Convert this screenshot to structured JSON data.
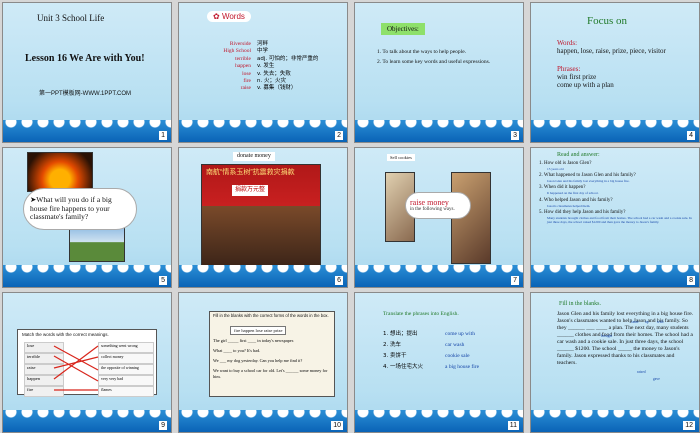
{
  "colors": {
    "accent_red": "#c0172c",
    "accent_blue": "#1646a8",
    "wave": "#0a63b6"
  },
  "slides": [
    {
      "num": "1",
      "unit": "Unit 3  School Life",
      "lesson": "Lesson 16  We Are with You!",
      "site": "第一PPT模板网-WWW.1PPT.COM"
    },
    {
      "num": "2",
      "heading": "Words",
      "words": [
        {
          "en": "Riverside",
          "cn": "河畔"
        },
        {
          "en": "High School",
          "cn": "中学"
        },
        {
          "en": "terrible",
          "cn": "adj. 可怕的；非常严重的"
        },
        {
          "en": "happen",
          "cn": "v. 发生"
        },
        {
          "en": "lose",
          "cn": "v. 失去；失败"
        },
        {
          "en": "fire",
          "cn": "n. 火；火灾"
        },
        {
          "en": "raise",
          "cn": "v. 募集（钱财）"
        }
      ]
    },
    {
      "num": "3",
      "heading": "Objectives:",
      "items": [
        "1. To talk about the ways to help people.",
        "2. To learn some key words and useful expressions."
      ]
    },
    {
      "num": "4",
      "heading": "Focus on",
      "words_label": "Words:",
      "words": "happen, lose, raise, prize, piece, visitor",
      "phrases_label": "Phrases:",
      "phrases": [
        "win first prize",
        "come up with a plan"
      ]
    },
    {
      "num": "5",
      "question": "What will you do if a big house fire happens to your classmate's family?"
    },
    {
      "num": "6",
      "label": "donate money",
      "banner": "南航“情系玉树”抗震救灾捐款",
      "board": "捐款万元整"
    },
    {
      "num": "7",
      "tag": "Sell cookies",
      "bubble": "raise money",
      "bubble_sub": "in the following ways."
    },
    {
      "num": "8",
      "heading": "Read and answer:",
      "qa": [
        {
          "q": "1. How old is Jason Glen?",
          "a": "15 years old"
        },
        {
          "q": "2. What happened to Jason Glen and his family?",
          "a": "Jason Glen and his family lost everything in a big house fire."
        },
        {
          "q": "3. When did it happen?",
          "a": "It happened on the first day of school."
        },
        {
          "q": "4. Who helped Jason and his family?",
          "a": "Jason's classmates helped them."
        },
        {
          "q": "5. How did they help Jason and his family?",
          "a": "Many students brought clothes and food from their homes. The school had a car wash and a cookie sale. In just three days, the school raised $1200 and then gave the money to Jason's family."
        }
      ]
    },
    {
      "num": "9",
      "heading": "Match the words with the correct meanings.",
      "left": [
        "lose",
        "terrible",
        "raise",
        "happen",
        "fire"
      ],
      "right": [
        "something went wrong",
        "collect money",
        "the opposite of winning",
        "very very bad",
        "flames"
      ]
    },
    {
      "num": "10",
      "heading": "Fill in the blanks with the correct forms of the words in the box.",
      "box": "fire  happen  lose  raise  prize",
      "lines": [
        "The girl _____ first ____ in today's newspaper.",
        "What ____ to you? It's bad.",
        "We ___ my dog yesterday. Can you help me find it?",
        "We want to buy a school car for old. Let's ______ some money for him."
      ]
    },
    {
      "num": "11",
      "heading": "Translate the phrases into English.",
      "rows": [
        {
          "cn": "1. 想出；提出",
          "en": "come up with"
        },
        {
          "cn": "2. 洗车",
          "en": "car wash"
        },
        {
          "cn": "3. 卖饼干",
          "en": "cookie sale"
        },
        {
          "cn": "4. 一场住宅大火",
          "en": "a big house fire"
        }
      ]
    },
    {
      "num": "12",
      "heading": "Fill in the blanks.",
      "passage": "Jason Glen and his family lost everything in a big house fire. Jason's classmates wanted to help Jason and his family. So they ______ ___ ____ a plan. The next day, many students ______ clothes and food from their homes. The school had a car wash and a cookie sale. In just three days, the school ______ $1200. The school _____ the money to Jason's family. Jason expressed thanks to his classmates and teachers.",
      "fills": [
        "came",
        "up",
        "with",
        "brought",
        "raised",
        "gave"
      ]
    }
  ]
}
